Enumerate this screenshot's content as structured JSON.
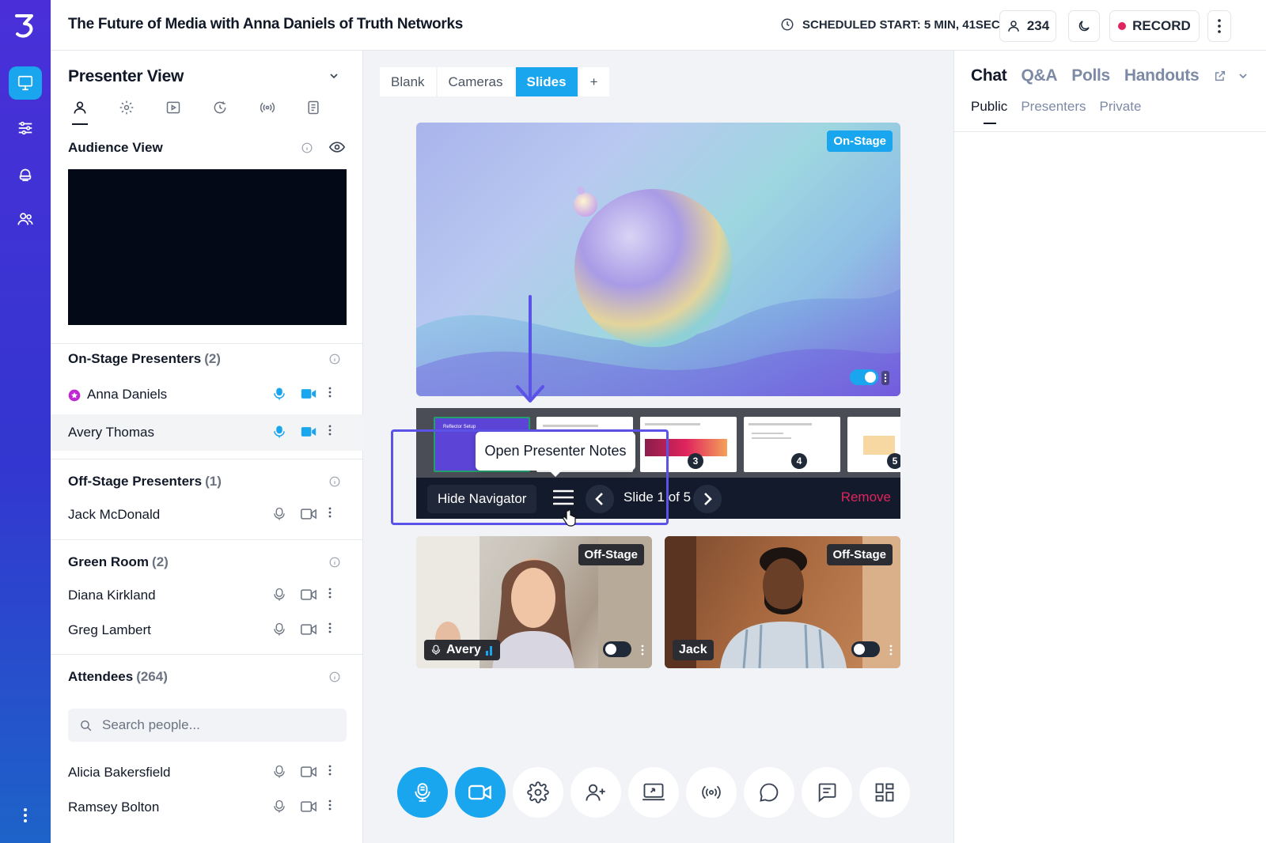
{
  "app": {
    "title": "The Future of Media with Anna Daniels of Truth Networks",
    "scheduled_start": "SCHEDULED START: 5 MIN, 41SEC",
    "attendee_count": "234",
    "record_label": "RECORD",
    "accent_color": "#19a6ee",
    "record_dot_color": "#e0245e"
  },
  "rail": {
    "items": [
      "presenter-icon",
      "sliders-icon",
      "green-room-icon",
      "attendees-icon"
    ],
    "active_index": 0
  },
  "left": {
    "panel_title": "Presenter View",
    "tabs": [
      "person-icon",
      "gear-icon",
      "play-icon",
      "history-icon",
      "broadcast-icon",
      "notes-icon"
    ],
    "audience_view_label": "Audience View",
    "onstage": {
      "title": "On-Stage Presenters",
      "count": "(2)",
      "people": [
        {
          "name": "Anna Daniels",
          "host": true
        },
        {
          "name": "Avery Thomas",
          "host": false
        }
      ]
    },
    "offstage": {
      "title": "Off-Stage Presenters",
      "count": "(1)",
      "people": [
        {
          "name": "Jack McDonald"
        }
      ]
    },
    "greenroom": {
      "title": "Green Room",
      "count": "(2)",
      "people": [
        {
          "name": "Diana Kirkland"
        },
        {
          "name": "Greg Lambert"
        }
      ]
    },
    "attendees": {
      "title": "Attendees",
      "count": "(264)",
      "search_placeholder": "Search people...",
      "people": [
        {
          "name": "Alicia Bakersfield"
        },
        {
          "name": "Ramsey Bolton"
        }
      ]
    }
  },
  "center": {
    "source_tabs": [
      "Blank",
      "Cameras",
      "Slides",
      "+"
    ],
    "active_tab": "Slides",
    "stage_badge": "On-Stage",
    "slide_toggle_on": true,
    "thumbs": {
      "first_title": "Reflector Setup",
      "numbers": [
        "3",
        "4",
        "5"
      ]
    },
    "navigator": {
      "hide_label": "Hide Navigator",
      "slide_position": "Slide 1 of 5",
      "remove_label": "Remove",
      "tooltip": "Open Presenter Notes"
    },
    "videos": [
      {
        "name": "Avery",
        "badge": "Off-Stage",
        "toggle_on": false
      },
      {
        "name": "Jack",
        "badge": "Off-Stage",
        "toggle_on": false
      }
    ],
    "controls": [
      "mic-icon",
      "camera-icon",
      "gear-icon",
      "add-person-icon",
      "screen-share-icon",
      "broadcast-icon",
      "chat-bubble-icon",
      "message-icon",
      "layout-grid-icon"
    ]
  },
  "right": {
    "tabs": [
      "Chat",
      "Q&A",
      "Polls",
      "Handouts"
    ],
    "active_tab": "Chat",
    "subtabs": [
      "Public",
      "Presenters",
      "Private"
    ],
    "active_subtab": "Public"
  }
}
